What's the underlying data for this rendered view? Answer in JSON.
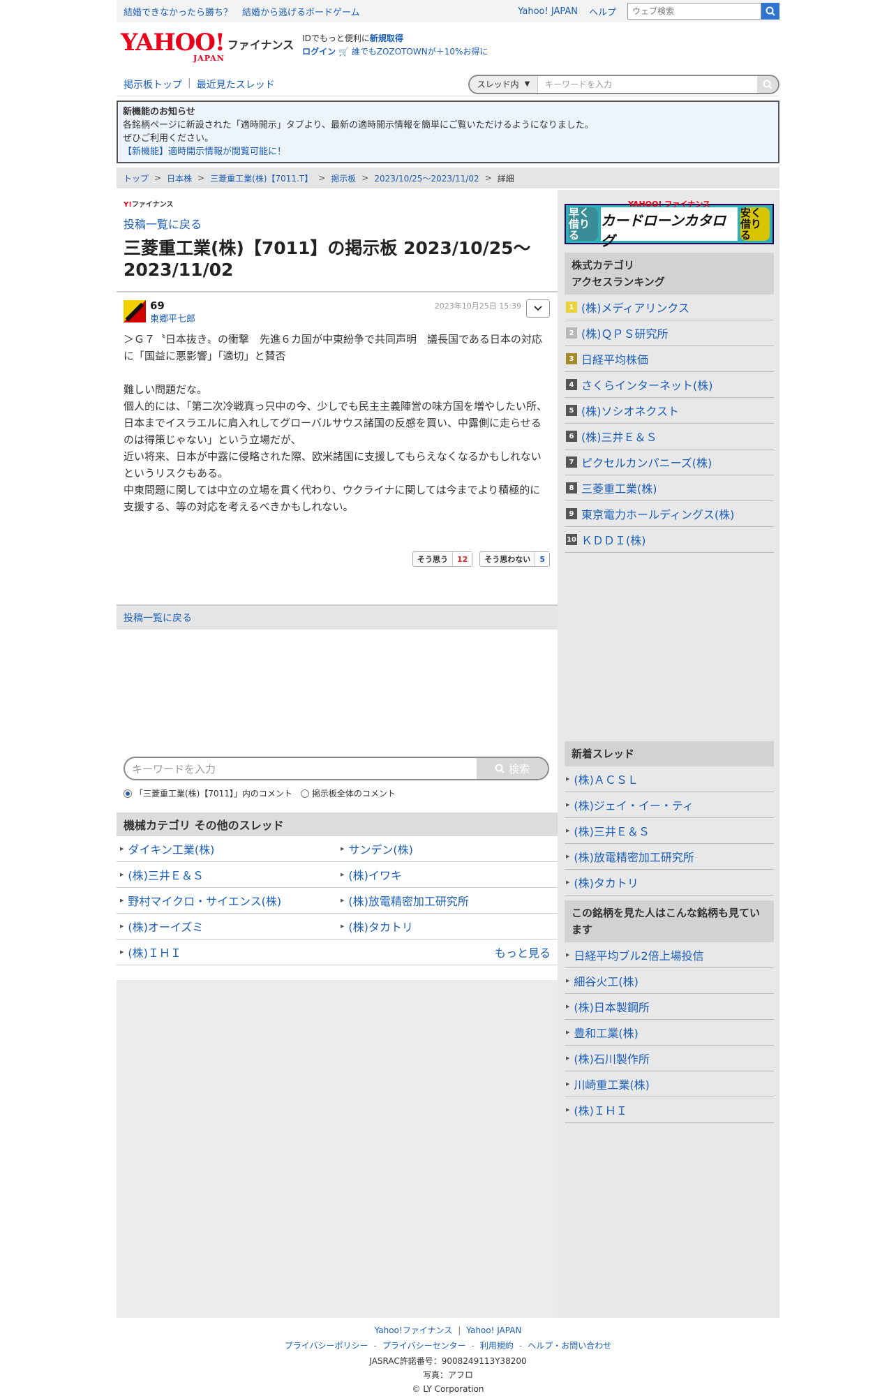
{
  "topbar": {
    "promo1": "結婚できなかったら勝ち？",
    "promo2": "結婚から逃げるボードゲーム",
    "yahoo_japan": "Yahoo! JAPAN",
    "help": "ヘルプ",
    "web_search_placeholder": "ウェブ検索"
  },
  "header": {
    "logo": "YAHOO!",
    "logo_sub": "JAPAN",
    "logo_service": "ファイナンス",
    "id_text": "IDでもっと便利に",
    "id_link": "新規取得",
    "login": "ログイン",
    "zozo": "誰でもZOZOTOWNが＋10%お得に"
  },
  "nav": {
    "board_top": "掲示板トップ",
    "sep": "|",
    "recent": "最近見たスレッド",
    "scope": "スレッド内",
    "keyword_placeholder": "キーワードを入力"
  },
  "notice": {
    "title": "新機能のお知らせ",
    "line1": "各銘柄ページに新設された「適時開示」タブより、最新の適時開示情報を簡単にご覧いただけるようになりました。",
    "line2": "ぜひご利用ください。",
    "link": "【新機能】適時開示情報が閲覧可能に！"
  },
  "breadcrumb": [
    "トップ",
    "日本株",
    "三菱重工業(株)【7011.T】",
    "掲示板",
    "2023/10/25〜2023/11/02",
    "詳細"
  ],
  "content": {
    "ymini": "ファイナンス",
    "back": "投稿一覧に戻る",
    "title": "三菱重工業(株)【7011】の掲示板 2023/10/25〜2023/11/02",
    "post": {
      "number": "69",
      "user": "東郷平七郎",
      "date": "2023年10月25日 15:39",
      "body": "＞Ｇ７〝日本抜き〟の衝撃　先進６カ国が中東紛争で共同声明　議長国である日本の対応に「国益に悪影響」「適切」と賛否\n\n難しい問題だな。\n個人的には、「第二次冷戦真っ只中の今、少しでも民主主義陣営の味方国を増やしたい所、日本までイスラエルに肩入れしてグローバルサウス諸国の反感を買い、中露側に走らせるのは得策じゃない」という立場だが、\n近い将来、日本が中露に侵略された際、欧米諸国に支援してもらえなくなるかもしれない\nというリスクもある。\n中東問題に関しては中立の立場を貫く代わり、ウクライナに関しては今までより積極的に支援する、等の対応を考えるべきかもしれない。",
      "agree_label": "そう思う",
      "agree_count": "12",
      "disagree_label": "そう思わない",
      "disagree_count": "5"
    },
    "back_bottom": "投稿一覧に戻る",
    "search": {
      "placeholder": "キーワードを入力",
      "button": "検索",
      "radio1": "「三菱重工業(株)【7011】」内のコメント",
      "radio2": "掲示板全体のコメント"
    },
    "category": {
      "title": "機械カテゴリ その他のスレッド",
      "items": [
        "ダイキン工業(株)",
        "サンデン(株)",
        "(株)三井Ｅ＆Ｓ",
        "(株)イワキ",
        "野村マイクロ・サイエンス(株)",
        "(株)放電精密加工研究所",
        "(株)オーイズミ",
        "(株)タカトリ",
        "(株)ＩＨＩ"
      ],
      "more": "もっと見る"
    }
  },
  "sidebar": {
    "banner": {
      "left": "早く借りる",
      "brand": "YAHOO! ファイナンス",
      "center": "カードローンカタログ",
      "right": "安く借りる"
    },
    "ranking_title": "株式カテゴリ\nアクセスランキング",
    "ranking": [
      {
        "rank": "1",
        "name": "(株)メディアリンクス"
      },
      {
        "rank": "2",
        "name": "(株)ＱＰＳ研究所"
      },
      {
        "rank": "3",
        "name": "日経平均株価"
      },
      {
        "rank": "4",
        "name": "さくらインターネット(株)"
      },
      {
        "rank": "5",
        "name": "(株)ソシオネクスト"
      },
      {
        "rank": "6",
        "name": "(株)三井Ｅ＆Ｓ"
      },
      {
        "rank": "7",
        "name": "ピクセルカンパニーズ(株)"
      },
      {
        "rank": "8",
        "name": "三菱重工業(株)"
      },
      {
        "rank": "9",
        "name": "東京電力ホールディングス(株)"
      },
      {
        "rank": "10",
        "name": "ＫＤＤＩ(株)"
      }
    ],
    "new_threads_title": "新着スレッド",
    "new_threads": [
      "(株)ＡＣＳＬ",
      "(株)ジェイ・イー・ティ",
      "(株)三井Ｅ＆Ｓ",
      "(株)放電精密加工研究所",
      "(株)タカトリ"
    ],
    "also_viewed_title": "この銘柄を見た人はこんな銘柄も見ています",
    "also_viewed": [
      "日経平均ブル2倍上場投信",
      "細谷火工(株)",
      "(株)日本製鋼所",
      "豊和工業(株)",
      "(株)石川製作所",
      "川崎重工業(株)",
      "(株)ＩＨＩ"
    ]
  },
  "footer": {
    "yf": "Yahoo!ファイナンス",
    "yj": "Yahoo! JAPAN",
    "privacy_policy": "プライバシーポリシー",
    "privacy_center": "プライバシーセンター",
    "terms": "利用規約",
    "help": "ヘルプ・お問い合わせ",
    "jasrac": "JASRAC許諾番号：9008249113Y38200",
    "photo": "写真：アフロ",
    "copyright": "© LY Corporation"
  }
}
